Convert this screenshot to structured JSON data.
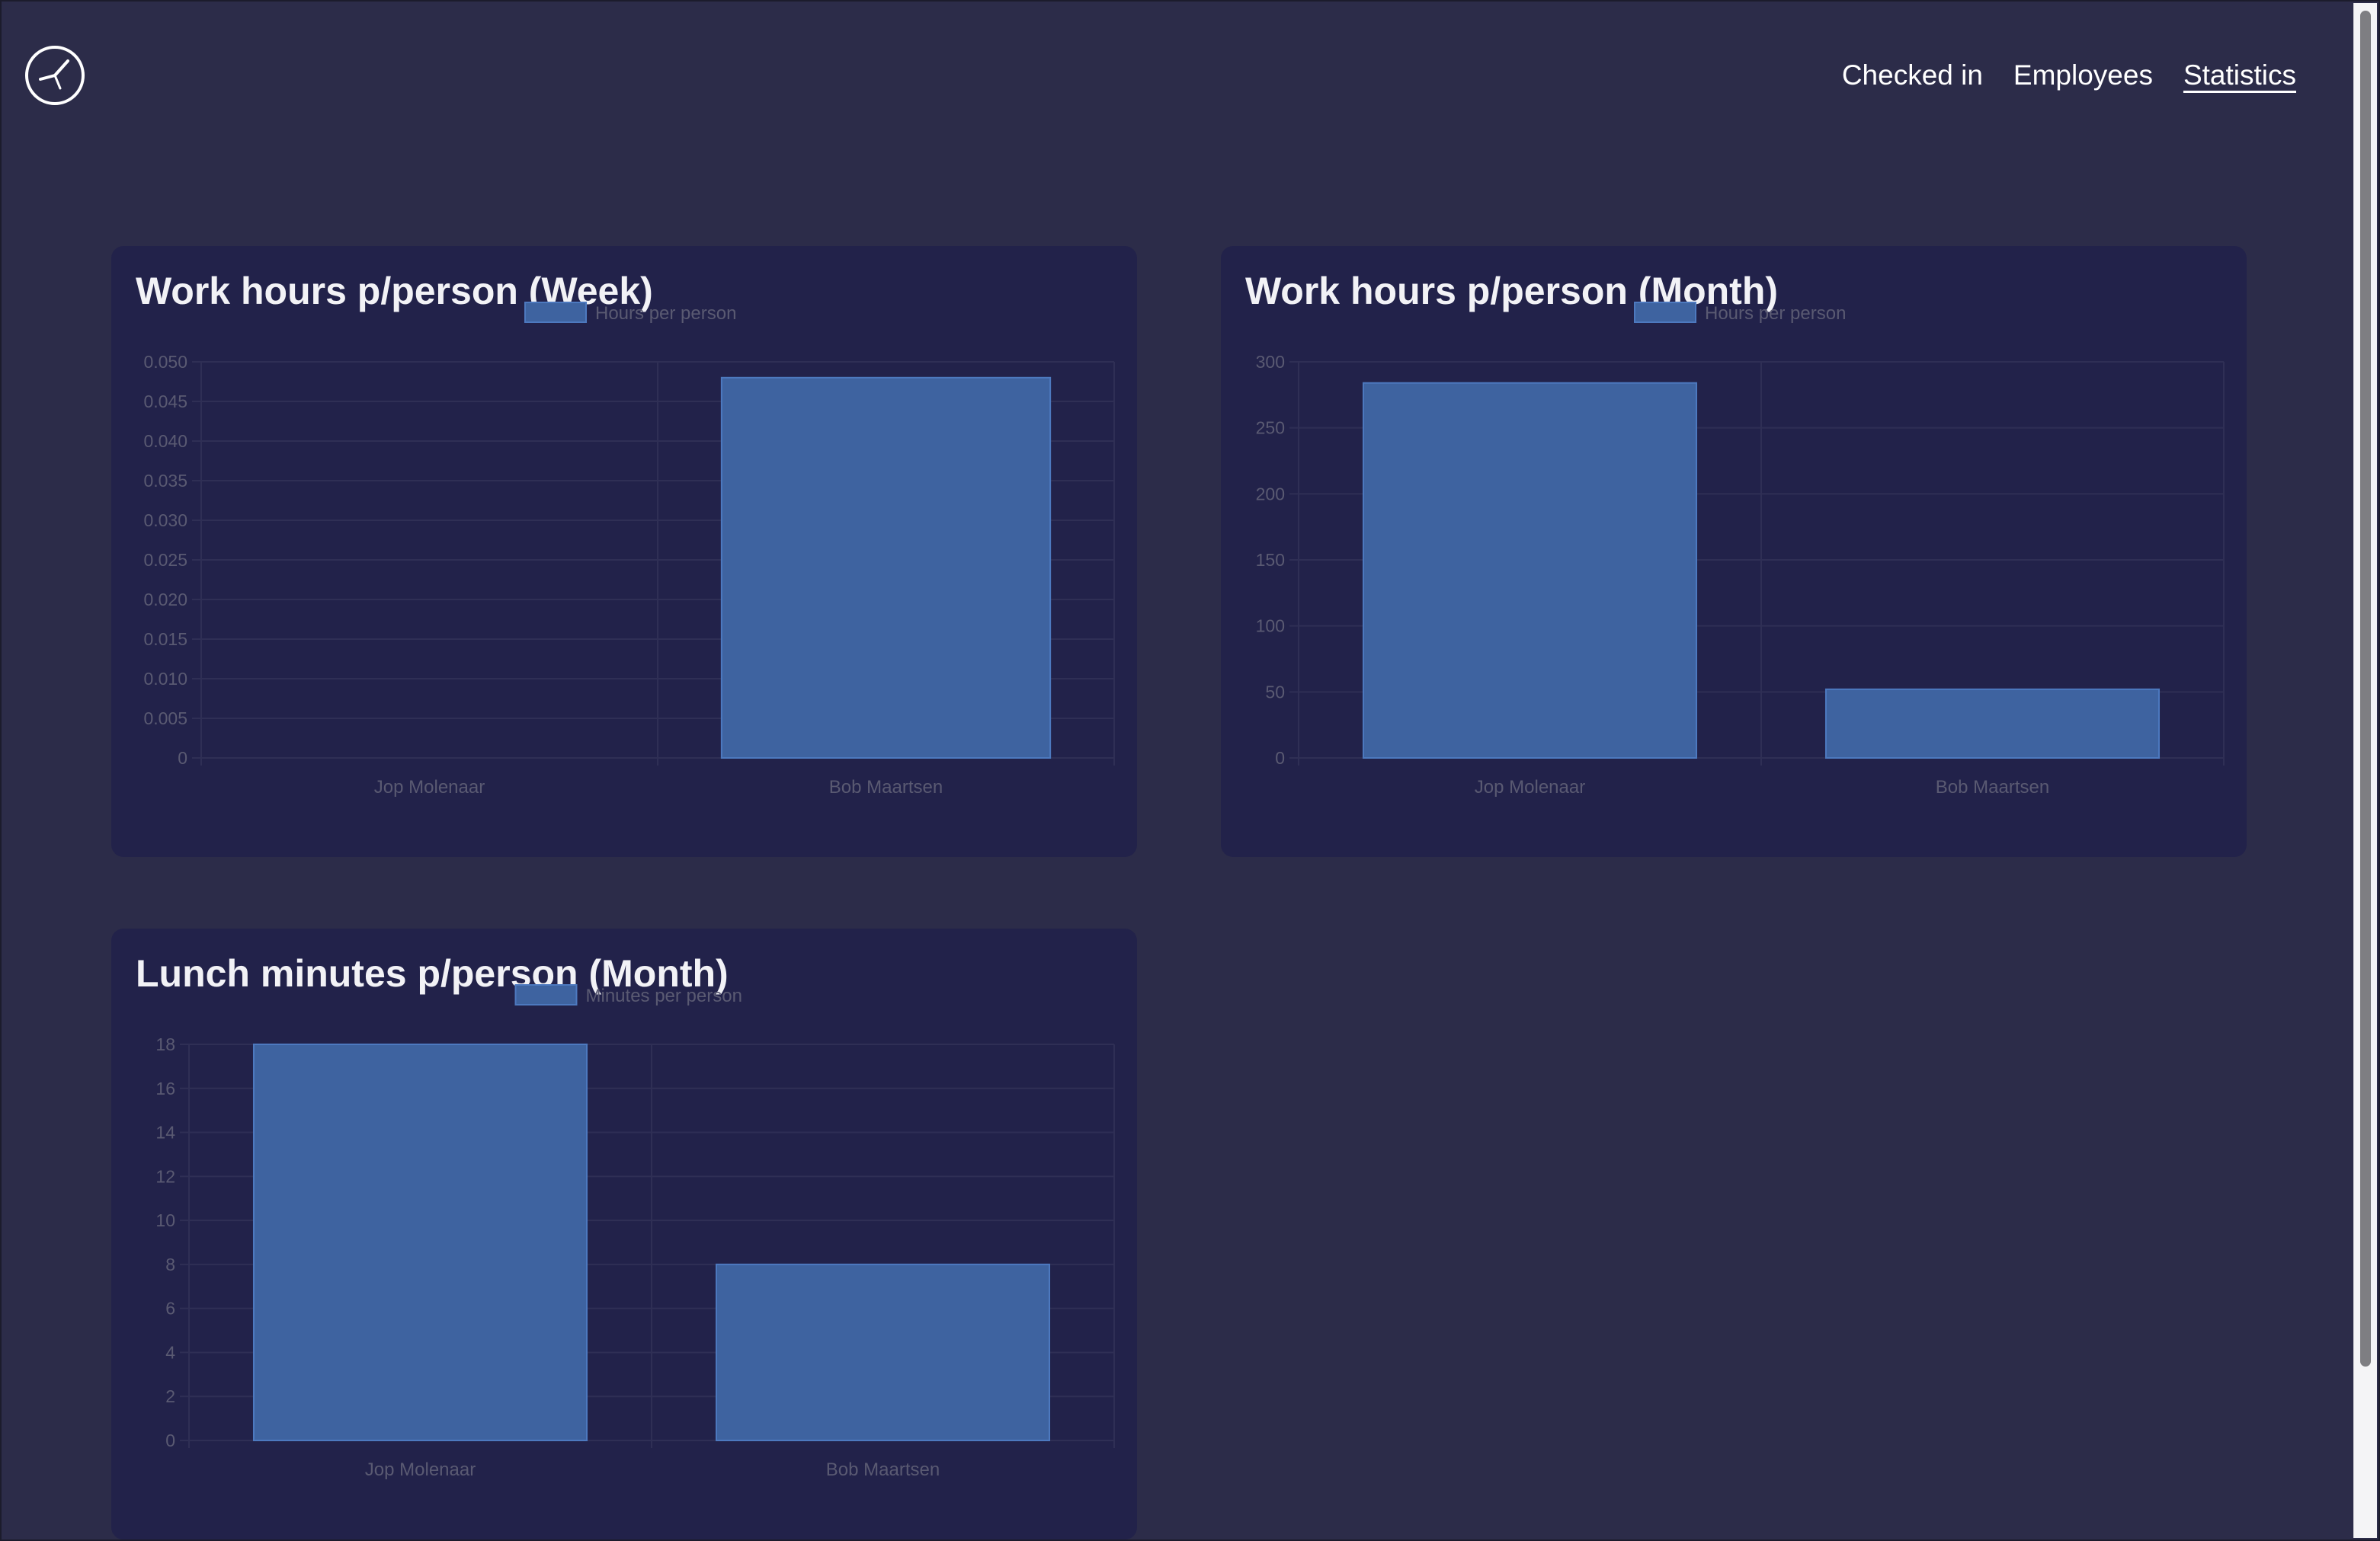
{
  "app": {
    "logo_icon": "clock-logo-icon"
  },
  "nav": {
    "items": [
      {
        "label": "Checked in",
        "active": false
      },
      {
        "label": "Employees",
        "active": false
      },
      {
        "label": "Statistics",
        "active": true
      }
    ]
  },
  "colors": {
    "background": "#2c2c49",
    "card": "#22224a",
    "bar_fill": "#3e63a0",
    "bar_stroke": "#4d79bf",
    "grid": "#2f2f55",
    "tick_text": "#5a5a72"
  },
  "chart_data": [
    {
      "type": "bar",
      "title": "Work hours p/person (Week)",
      "legend": "Hours per person",
      "categories": [
        "Jop Molenaar",
        "Bob Maartsen"
      ],
      "values": [
        0,
        0.048
      ],
      "ylim": [
        0,
        0.05
      ],
      "yticks": [
        "0",
        "0.005",
        "0.010",
        "0.015",
        "0.020",
        "0.025",
        "0.030",
        "0.035",
        "0.040",
        "0.045",
        "0.050"
      ],
      "grid": true,
      "legend_position": "top"
    },
    {
      "type": "bar",
      "title": "Work hours p/person (Month)",
      "legend": "Hours per person",
      "categories": [
        "Jop Molenaar",
        "Bob Maartsen"
      ],
      "values": [
        284,
        52
      ],
      "ylim": [
        0,
        300
      ],
      "yticks": [
        "0",
        "50",
        "100",
        "150",
        "200",
        "250",
        "300"
      ],
      "grid": true,
      "legend_position": "top"
    },
    {
      "type": "bar",
      "title": "Lunch minutes p/person (Month)",
      "legend": "Minutes per person",
      "categories": [
        "Jop Molenaar",
        "Bob Maartsen"
      ],
      "values": [
        18,
        8
      ],
      "ylim": [
        0,
        18
      ],
      "yticks": [
        "0",
        "2",
        "4",
        "6",
        "8",
        "10",
        "12",
        "14",
        "16",
        "18"
      ],
      "grid": true,
      "legend_position": "top"
    }
  ]
}
